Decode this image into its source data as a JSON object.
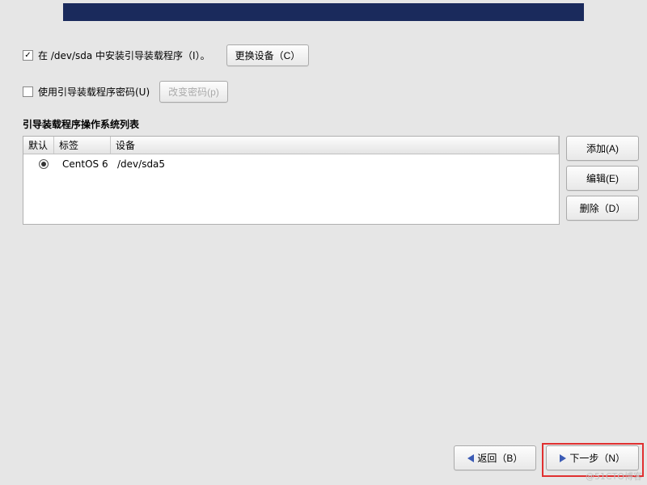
{
  "checkbox1": {
    "label": "在 /dev/sda 中安装引导装载程序（I）。",
    "checked": true
  },
  "change_device_btn": "更换设备（C）",
  "checkbox2": {
    "label": "使用引导装载程序密码(U)",
    "checked": false
  },
  "change_password_btn": "改变密码(p)",
  "section_title": "引导装载程序操作系统列表",
  "table": {
    "headers": {
      "default": "默认",
      "label": "标签",
      "device": "设备"
    },
    "rows": [
      {
        "default_selected": true,
        "label": "CentOS 6",
        "device": "/dev/sda5"
      }
    ]
  },
  "side_buttons": {
    "add": "添加(A)",
    "edit": "编辑(E)",
    "delete": "删除（D）"
  },
  "footer": {
    "back": "返回（B）",
    "next": "下一步（N）"
  },
  "watermark": "@51CTO博客"
}
